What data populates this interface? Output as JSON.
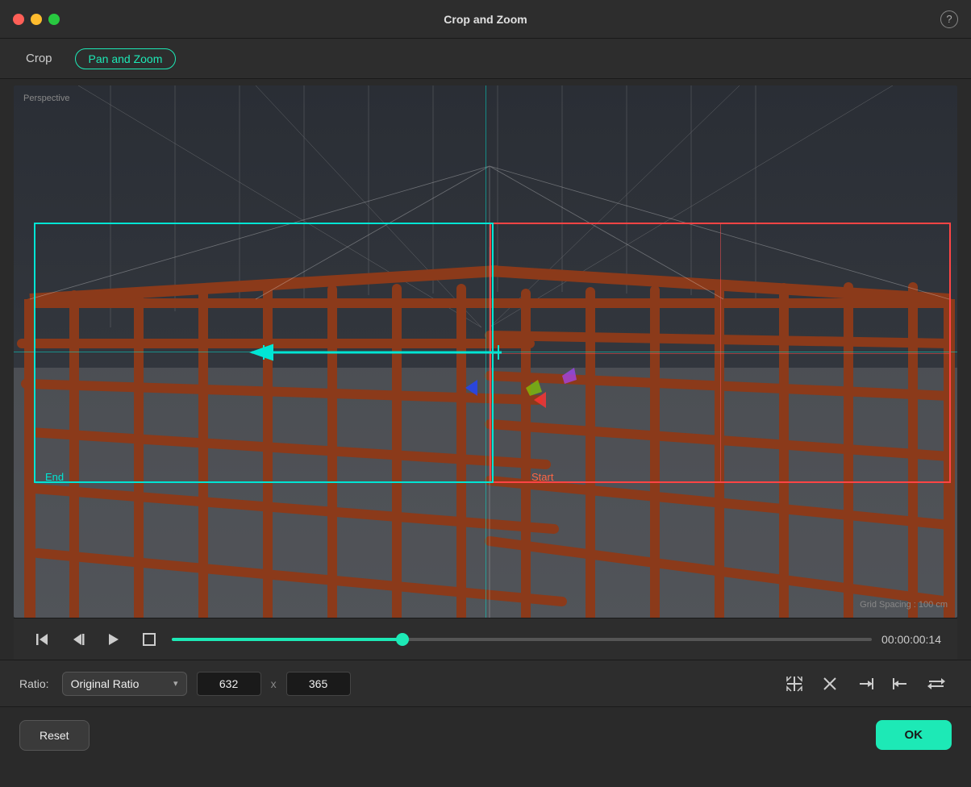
{
  "window": {
    "title": "Crop and Zoom",
    "help_label": "?"
  },
  "window_controls": {
    "close": "close",
    "minimize": "minimize",
    "maximize": "maximize"
  },
  "tabs": {
    "crop_label": "Crop",
    "pan_zoom_label": "Pan and Zoom"
  },
  "viewport": {
    "perspective_label": "Perspective",
    "grid_spacing_label": "Grid Spacing : 100 cm"
  },
  "frames": {
    "start_label": "Start",
    "end_label": "End"
  },
  "timeline": {
    "time": "00:00:00:14"
  },
  "controls": {
    "ratio_label": "Ratio:",
    "ratio_value": "Original Ratio",
    "width": "632",
    "height": "365",
    "dim_separator": "x"
  },
  "footer": {
    "reset_label": "Reset",
    "ok_label": "OK"
  },
  "icons": {
    "step_back": "⟨|",
    "frame_back": "|▷",
    "play": "▷",
    "stop": "□",
    "fit_width": "⤢",
    "close_x": "✕",
    "snap_right": "→|",
    "snap_left": "|←",
    "swap": "⇄"
  }
}
